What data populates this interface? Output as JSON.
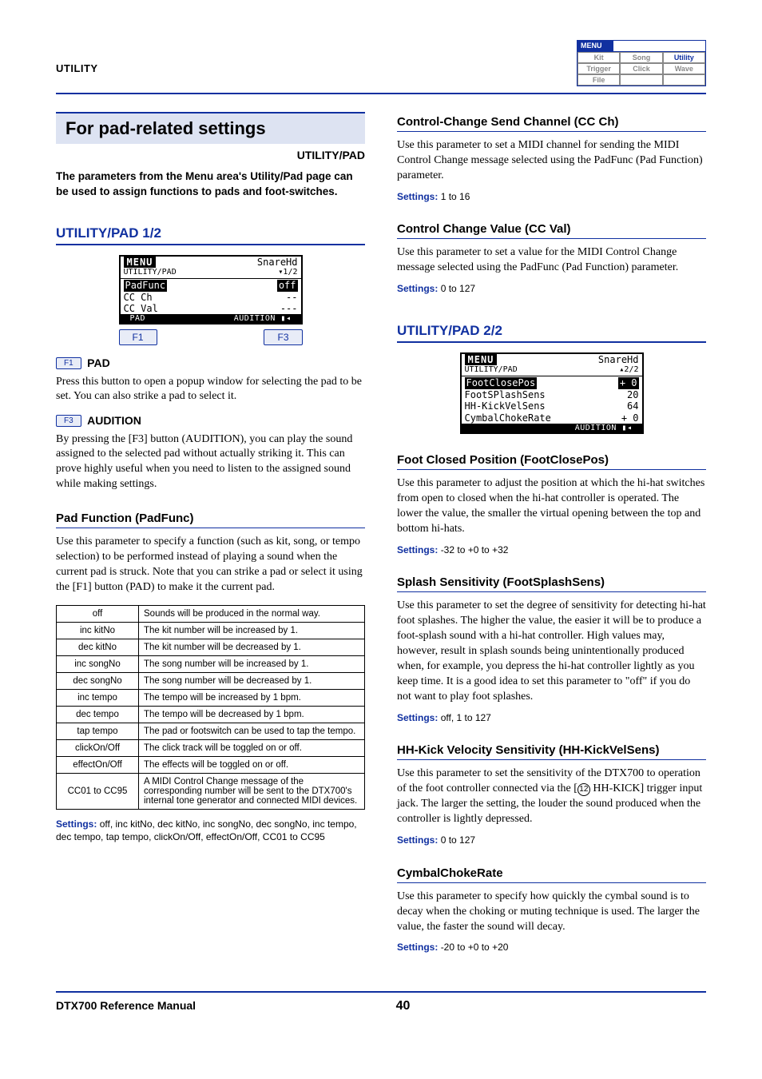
{
  "header": {
    "section": "UTILITY",
    "menu_tab": "MENU",
    "menu_cells": [
      "Kit",
      "Song",
      "Utility",
      "Trigger",
      "Click",
      "Wave",
      "File",
      "",
      ""
    ],
    "active_cell_index": 2
  },
  "left": {
    "box_title": "For pad-related settings",
    "right_label": "UTILITY/PAD",
    "intro": "The parameters from the Menu area's Utility/Pad page can be used to assign functions to pads and foot-switches.",
    "subhead1": "UTILITY/PAD 1/2",
    "lcd1": {
      "tab": "MENU",
      "topright": "SnareHd",
      "line2l": "UTILITY/PAD",
      "line2r": "▾1/2",
      "rows": [
        {
          "l": "PadFunc",
          "r": "off",
          "inv": true
        },
        {
          "l": " CC Ch",
          "r": "--"
        },
        {
          "l": " CC Val",
          "r": "---"
        }
      ],
      "bl": "PAD",
      "br": "AUDITION ▮◂"
    },
    "fkeys": {
      "f1": "F1",
      "f3": "F3"
    },
    "pad_label": "PAD",
    "pad_text": "Press this button to open a popup window for selecting the pad to be set. You can also strike a pad to select it.",
    "aud_label": "AUDITION",
    "aud_text": "By pressing the [F3] button (AUDITION), you can play the sound assigned to the selected pad without actually striking it. This can prove highly useful when you need to listen to the assigned sound while making settings.",
    "padfunc_head": "Pad Function (PadFunc)",
    "padfunc_text": "Use this parameter to specify a function (such as kit, song, or tempo selection) to be performed instead of playing a sound when the current pad is struck. Note that you can strike a pad or select it using the [F1] button (PAD) to make it the current pad.",
    "table": [
      {
        "k": "off",
        "v": "Sounds will be produced in the normal way."
      },
      {
        "k": "inc kitNo",
        "v": "The kit number will be increased by 1."
      },
      {
        "k": "dec kitNo",
        "v": "The kit number will be decreased by 1."
      },
      {
        "k": "inc songNo",
        "v": "The song number will be increased by 1."
      },
      {
        "k": "dec songNo",
        "v": "The song number will be decreased by 1."
      },
      {
        "k": "inc tempo",
        "v": "The tempo will be increased by 1 bpm."
      },
      {
        "k": "dec tempo",
        "v": "The tempo will be decreased by 1 bpm."
      },
      {
        "k": "tap tempo",
        "v": "The pad or footswitch can be used to tap the tempo."
      },
      {
        "k": "clickOn/Off",
        "v": "The click track will be toggled on or off."
      },
      {
        "k": "effectOn/Off",
        "v": "The effects will be toggled on or off."
      },
      {
        "k": "CC01 to CC95",
        "v": "A MIDI Control Change message of the corresponding number will be sent to the DTX700's internal tone generator and connected MIDI devices."
      }
    ],
    "settings1": "off, inc kitNo, dec kitNo, inc songNo, dec songNo, inc tempo, dec tempo, tap tempo, clickOn/Off, effectOn/Off, CC01 to CC95"
  },
  "right": {
    "ccch_head": "Control-Change Send Channel (CC Ch)",
    "ccch_text": "Use this parameter to set a MIDI channel for sending the MIDI Control Change message selected using the PadFunc (Pad Function) parameter.",
    "ccch_settings": "1 to 16",
    "ccval_head": "Control Change Value (CC Val)",
    "ccval_text": "Use this parameter to set a value for the MIDI Control Change message selected using the PadFunc (Pad Function) parameter.",
    "ccval_settings": "0 to 127",
    "subhead2": "UTILITY/PAD 2/2",
    "lcd2": {
      "tab": "MENU",
      "topright": "SnareHd",
      "line2l": "UTILITY/PAD",
      "line2r": "▴2/2",
      "rows": [
        {
          "l": "FootClosePos",
          "r": "+ 0",
          "inv": true
        },
        {
          "l": "FootSPlashSens",
          "r": "20"
        },
        {
          "l": "HH-KickVelSens",
          "r": "64"
        },
        {
          "l": "CymbalChokeRate",
          "r": "+ 0"
        }
      ],
      "br": "AUDITION ▮◂"
    },
    "foot_head": "Foot Closed Position (FootClosePos)",
    "foot_text": "Use this parameter to adjust the position at which the hi-hat switches from open to closed when the hi-hat controller is operated. The lower the value, the smaller the virtual opening between the top and bottom hi-hats.",
    "foot_settings": "-32 to +0 to +32",
    "splash_head": "Splash Sensitivity (FootSplashSens)",
    "splash_text": "Use this parameter to set the degree of sensitivity for detecting hi-hat foot splashes. The higher the value, the easier it will be to produce a foot-splash sound with a hi-hat controller. High values may, however, result in splash sounds being unintentionally produced when, for example, you depress the hi-hat controller lightly as you keep time. It is a good idea to set this parameter to \"off\" if you do not want to play foot splashes.",
    "splash_settings": "off, 1 to 127",
    "hhkick_head": "HH-Kick Velocity Sensitivity (HH-KickVelSens)",
    "hhkick_text_pre": "Use this parameter to set the sensitivity of the DTX700 to operation of the foot controller connected via the [",
    "hhkick_circ": "12",
    "hhkick_text_post": " HH-KICK] trigger input jack. The larger the setting, the louder the sound produced when the controller is lightly depressed.",
    "hhkick_settings": "0 to 127",
    "choke_head": "CymbalChokeRate",
    "choke_text": "Use this parameter to specify how quickly the cymbal sound is to decay when the choking or muting technique is used. The larger the value, the faster the sound will decay.",
    "choke_settings": "-20 to +0 to +20"
  },
  "footer": {
    "manual": "DTX700  Reference Manual",
    "page": "40"
  },
  "labels": {
    "settings": "Settings:"
  }
}
